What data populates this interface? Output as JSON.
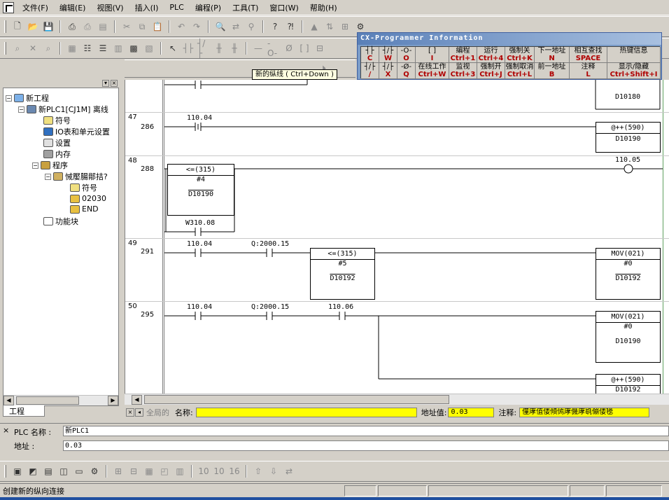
{
  "menu": [
    "文件(F)",
    "编辑(E)",
    "视图(V)",
    "插入(I)",
    "PLC",
    "编程(P)",
    "工具(T)",
    "窗口(W)",
    "帮助(H)"
  ],
  "tooltip": "新的纵线 ( Ctrl+Down )",
  "info_panel": {
    "title": "CX-Programmer Information",
    "top_row": [
      {
        "sym": "┤├",
        "key": "C"
      },
      {
        "sym": "┤/├",
        "key": "W"
      },
      {
        "sym": "-O-",
        "key": "O"
      },
      {
        "sym": "[ ]",
        "key": "I"
      },
      {
        "label": "编程",
        "key": "Ctrl+1"
      },
      {
        "label": "运行",
        "key": "Ctrl+4"
      },
      {
        "label": "强制关",
        "key": "Ctrl+K"
      },
      {
        "label": "下一地址",
        "key": "N"
      },
      {
        "label": "相互查找",
        "key": "SPACE"
      },
      {
        "label": "热键信息",
        "key": ""
      }
    ],
    "bottom_row": [
      {
        "sym": "┤/├",
        "key": "/"
      },
      {
        "sym": "┤/├",
        "key": "X"
      },
      {
        "sym": "-Ø-",
        "key": "Q"
      },
      {
        "label": "在线工作",
        "key": "Ctrl+W"
      },
      {
        "label": "监视",
        "key": "Ctrl+3"
      },
      {
        "label": "强制开",
        "key": "Ctrl+J"
      },
      {
        "label": "强制取消",
        "key": "Ctrl+L"
      },
      {
        "label": "前一地址",
        "key": "B"
      },
      {
        "label": "注释",
        "key": "L"
      },
      {
        "label": "显示/隐藏",
        "key": "Ctrl+Shift+I"
      }
    ]
  },
  "tree": {
    "items": [
      {
        "label": "新工程"
      },
      {
        "label": "新PLC1[CJ1M] 离线"
      },
      {
        "label": "符号"
      },
      {
        "label": "IO表和单元设置"
      },
      {
        "label": "设置"
      },
      {
        "label": "内存"
      },
      {
        "label": "程序"
      },
      {
        "label": "悈嬮腸鄁拮?"
      },
      {
        "label": "符号"
      },
      {
        "label": "02030"
      },
      {
        "label": "END"
      },
      {
        "label": "功能块"
      }
    ],
    "tab": "工程"
  },
  "ladder": {
    "rungs": [
      {
        "num": "47",
        "step": "286"
      },
      {
        "num": "48",
        "step": "288"
      },
      {
        "num": "49",
        "step": "291"
      },
      {
        "num": "50",
        "step": "295"
      }
    ],
    "labels": {
      "d10180": "D10180",
      "c47": "110.04",
      "inc590a": "@++(590)",
      "d10190a": "D10190",
      "cmp315a": "<=(315)",
      "h4": "#4",
      "d10190b": "D10190",
      "out110_05": "110.05",
      "w310": "W310.08",
      "c49a": "110.04",
      "c49b": "Q:2000.15",
      "cmp315b": "<=(315)",
      "h5": "#5",
      "d10192a": "D10192",
      "mov021a": "MOV(021)",
      "h0a": "#0",
      "d10192b": "D10192",
      "c50a": "110.04",
      "c50b": "Q:2000.15",
      "c50c": "110.06",
      "mov021b": "MOV(021)",
      "h0b": "#0",
      "d10190c": "D10190",
      "inc590b": "@++(590)",
      "d10192c": "D10192"
    }
  },
  "addr_bar": {
    "global": "全局的",
    "name_label": "名称:",
    "addr_label": "地址值:",
    "addr_value": "0.03",
    "comment_label": "注释:",
    "comment_value": "僮庨值偻傾傿庨僟庨毼傰偻毶"
  },
  "output": {
    "plc_label": "PLC 名称 :",
    "plc_value": "新PLC1",
    "addr_label": "地址 :",
    "addr_value": "0.03"
  },
  "status": {
    "text": "创建新的纵向连接"
  }
}
